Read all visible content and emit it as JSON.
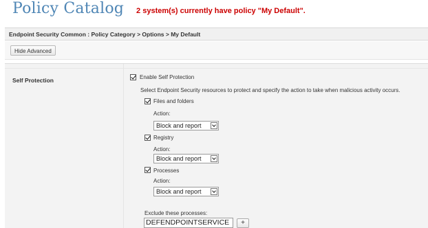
{
  "header": {
    "title": "Policy Catalog",
    "subtitle": "2 system(s) currently have policy \"My Default\"."
  },
  "breadcrumb": "Endpoint Security Common : Policy Category > Options > My Default",
  "toolbar": {
    "hide_advanced_label": "Hide Advanced"
  },
  "section": {
    "label": "Self Protection",
    "enable_label": "Enable Self Protection",
    "enable_checked": true,
    "description": "Select Endpoint Security resources to protect and specify the action to take when malicious activity occurs.",
    "resources": [
      {
        "label": "Files and folders",
        "checked": true,
        "action_label": "Action:",
        "action_value": "Block and report"
      },
      {
        "label": "Registry",
        "checked": true,
        "action_label": "Action:",
        "action_value": "Block and report"
      },
      {
        "label": "Processes",
        "checked": true,
        "action_label": "Action:",
        "action_value": "Block and report"
      }
    ],
    "exclude_label": "Exclude these processes:",
    "exclude_value": "DEFENDPOINTSERVICE",
    "add_button": "+"
  }
}
